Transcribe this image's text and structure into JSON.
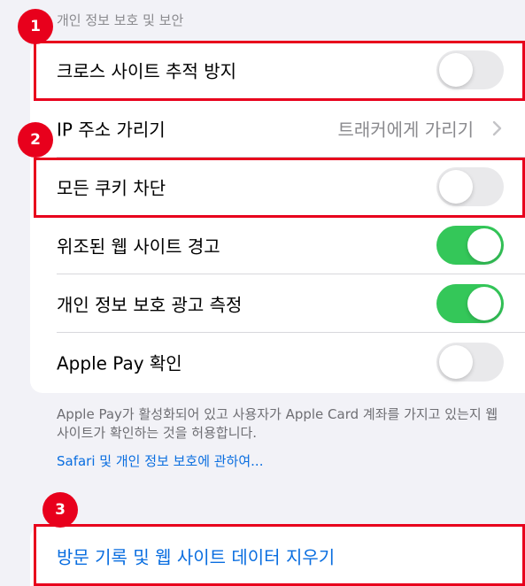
{
  "section_header": "개인 정보 보호 및 보안",
  "rows": [
    {
      "label": "크로스 사이트 추적 방지",
      "toggle": "off"
    },
    {
      "label": "IP 주소 가리기",
      "value": "트래커에게 가리기",
      "chevron": "chevron-right-icon"
    },
    {
      "label": "모든 쿠키 차단",
      "toggle": "off"
    },
    {
      "label": "위조된 웹 사이트 경고",
      "toggle": "on"
    },
    {
      "label": "개인 정보 보호 광고 측정",
      "toggle": "on"
    },
    {
      "label": "Apple Pay 확인",
      "toggle": "off"
    }
  ],
  "footer": {
    "description": "Apple Pay가 활성화되어 있고 사용자가 Apple Card 계좌를 가지고 있는지 웹 사이트가 확인하는 것을 허용합니다.",
    "link": "Safari 및 개인 정보 보호에 관하여..."
  },
  "clear_history": {
    "label": "방문 기록 및 웹 사이트 데이터 지우기"
  },
  "badges": [
    "1",
    "2",
    "3"
  ],
  "colors": {
    "toggle_on": "#34c759",
    "toggle_off": "#e9e9eb",
    "link": "#0a6ee0",
    "highlight": "#e8001c"
  }
}
